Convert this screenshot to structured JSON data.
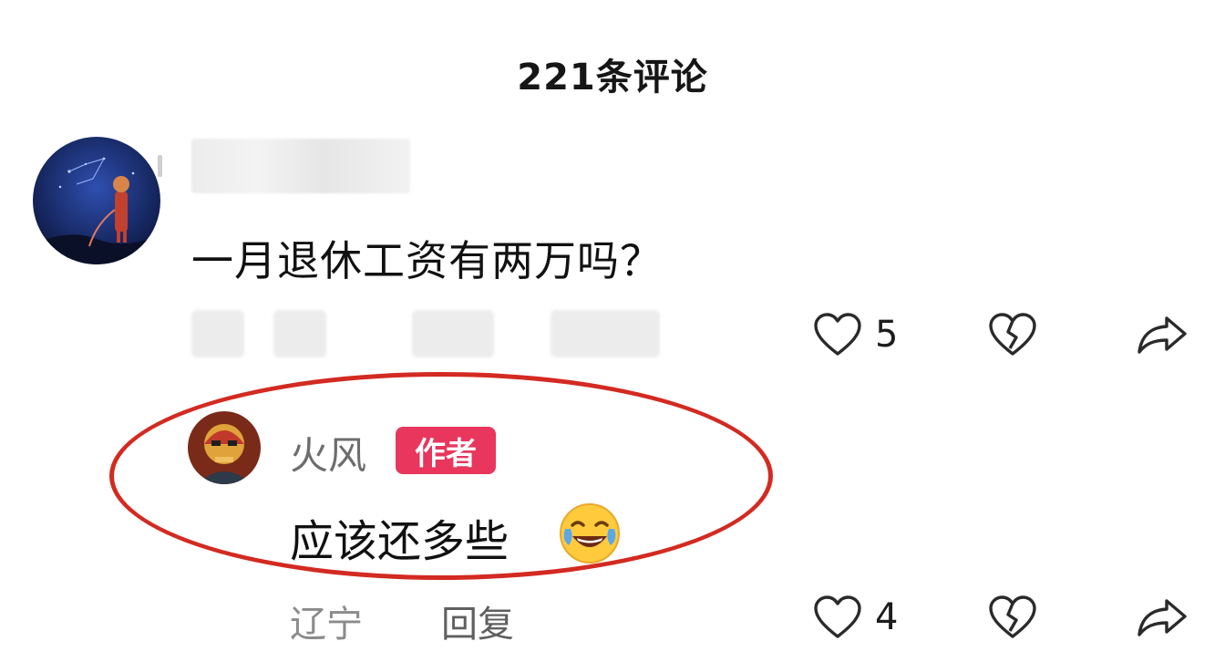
{
  "header": {
    "title": "221条评论"
  },
  "comment": {
    "text": "一月退休工资有两万吗？",
    "like_count": "5"
  },
  "reply": {
    "username": "火风",
    "badge": "作者",
    "text": "应该还多些",
    "emoji": "face-with-tears-of-joy",
    "location": "辽宁",
    "reply_label": "回复",
    "like_count": "4"
  },
  "colors": {
    "badge_bg": "#e8365d",
    "highlight_ring": "#d32a21"
  }
}
